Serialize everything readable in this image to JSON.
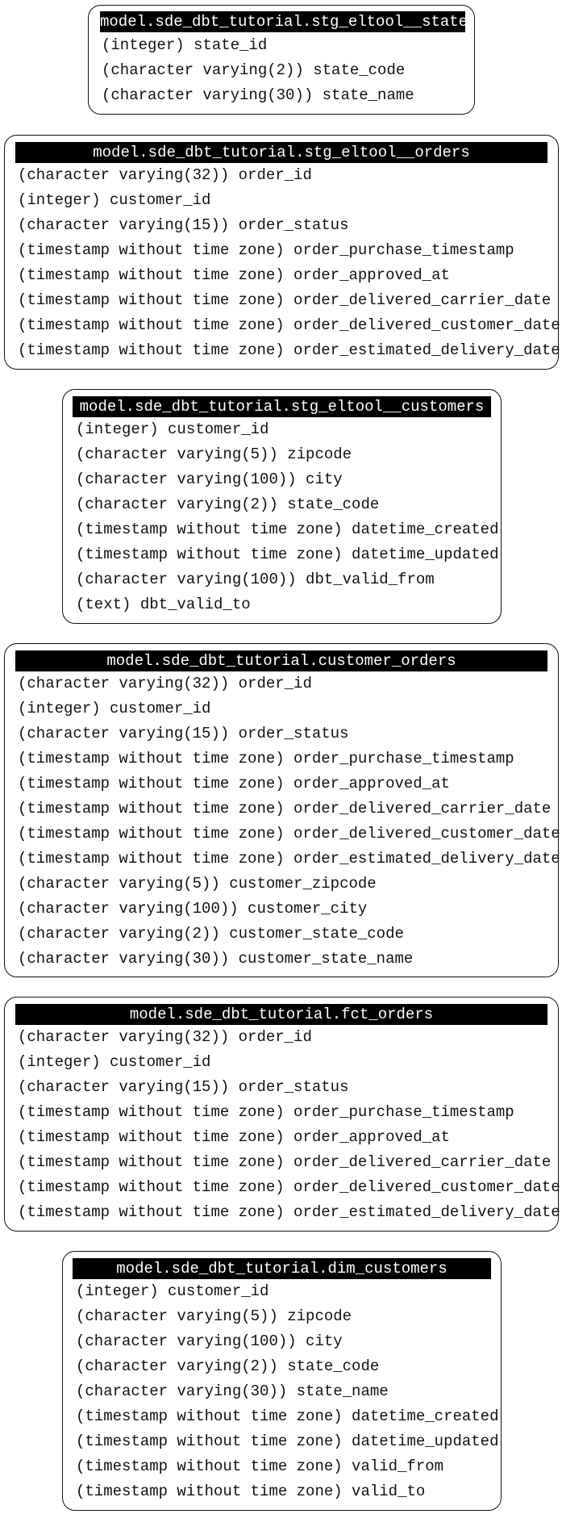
{
  "tables": [
    {
      "title": "model.sde_dbt_tutorial.stg_eltool__state",
      "columns": [
        "(integer) state_id",
        "(character varying(2)) state_code",
        "(character varying(30)) state_name"
      ]
    },
    {
      "title": "model.sde_dbt_tutorial.stg_eltool__orders",
      "columns": [
        "(character varying(32)) order_id",
        "(integer) customer_id",
        "(character varying(15)) order_status",
        "(timestamp without time zone) order_purchase_timestamp",
        "(timestamp without time zone) order_approved_at",
        "(timestamp without time zone) order_delivered_carrier_date",
        "(timestamp without time zone) order_delivered_customer_date",
        "(timestamp without time zone) order_estimated_delivery_date"
      ]
    },
    {
      "title": "model.sde_dbt_tutorial.stg_eltool__customers",
      "columns": [
        "(integer) customer_id",
        "(character varying(5)) zipcode",
        "(character varying(100)) city",
        "(character varying(2)) state_code",
        "(timestamp without time zone) datetime_created",
        "(timestamp without time zone) datetime_updated",
        "(character varying(100)) dbt_valid_from",
        "(text) dbt_valid_to"
      ]
    },
    {
      "title": "model.sde_dbt_tutorial.customer_orders",
      "columns": [
        "(character varying(32)) order_id",
        "(integer) customer_id",
        "(character varying(15)) order_status",
        "(timestamp without time zone) order_purchase_timestamp",
        "(timestamp without time zone) order_approved_at",
        "(timestamp without time zone) order_delivered_carrier_date",
        "(timestamp without time zone) order_delivered_customer_date",
        "(timestamp without time zone) order_estimated_delivery_date",
        "(character varying(5)) customer_zipcode",
        "(character varying(100)) customer_city",
        "(character varying(2)) customer_state_code",
        "(character varying(30)) customer_state_name"
      ]
    },
    {
      "title": "model.sde_dbt_tutorial.fct_orders",
      "columns": [
        "(character varying(32)) order_id",
        "(integer) customer_id",
        "(character varying(15)) order_status",
        "(timestamp without time zone) order_purchase_timestamp",
        "(timestamp without time zone) order_approved_at",
        "(timestamp without time zone) order_delivered_carrier_date",
        "(timestamp without time zone) order_delivered_customer_date",
        "(timestamp without time zone) order_estimated_delivery_date"
      ]
    },
    {
      "title": "model.sde_dbt_tutorial.dim_customers",
      "columns": [
        "(integer) customer_id",
        "(character varying(5)) zipcode",
        "(character varying(100)) city",
        "(character varying(2)) state_code",
        "(character varying(30)) state_name",
        "(timestamp without time zone) datetime_created",
        "(timestamp without time zone) datetime_updated",
        "(timestamp without time zone) valid_from",
        "(timestamp without time zone) valid_to"
      ]
    }
  ]
}
